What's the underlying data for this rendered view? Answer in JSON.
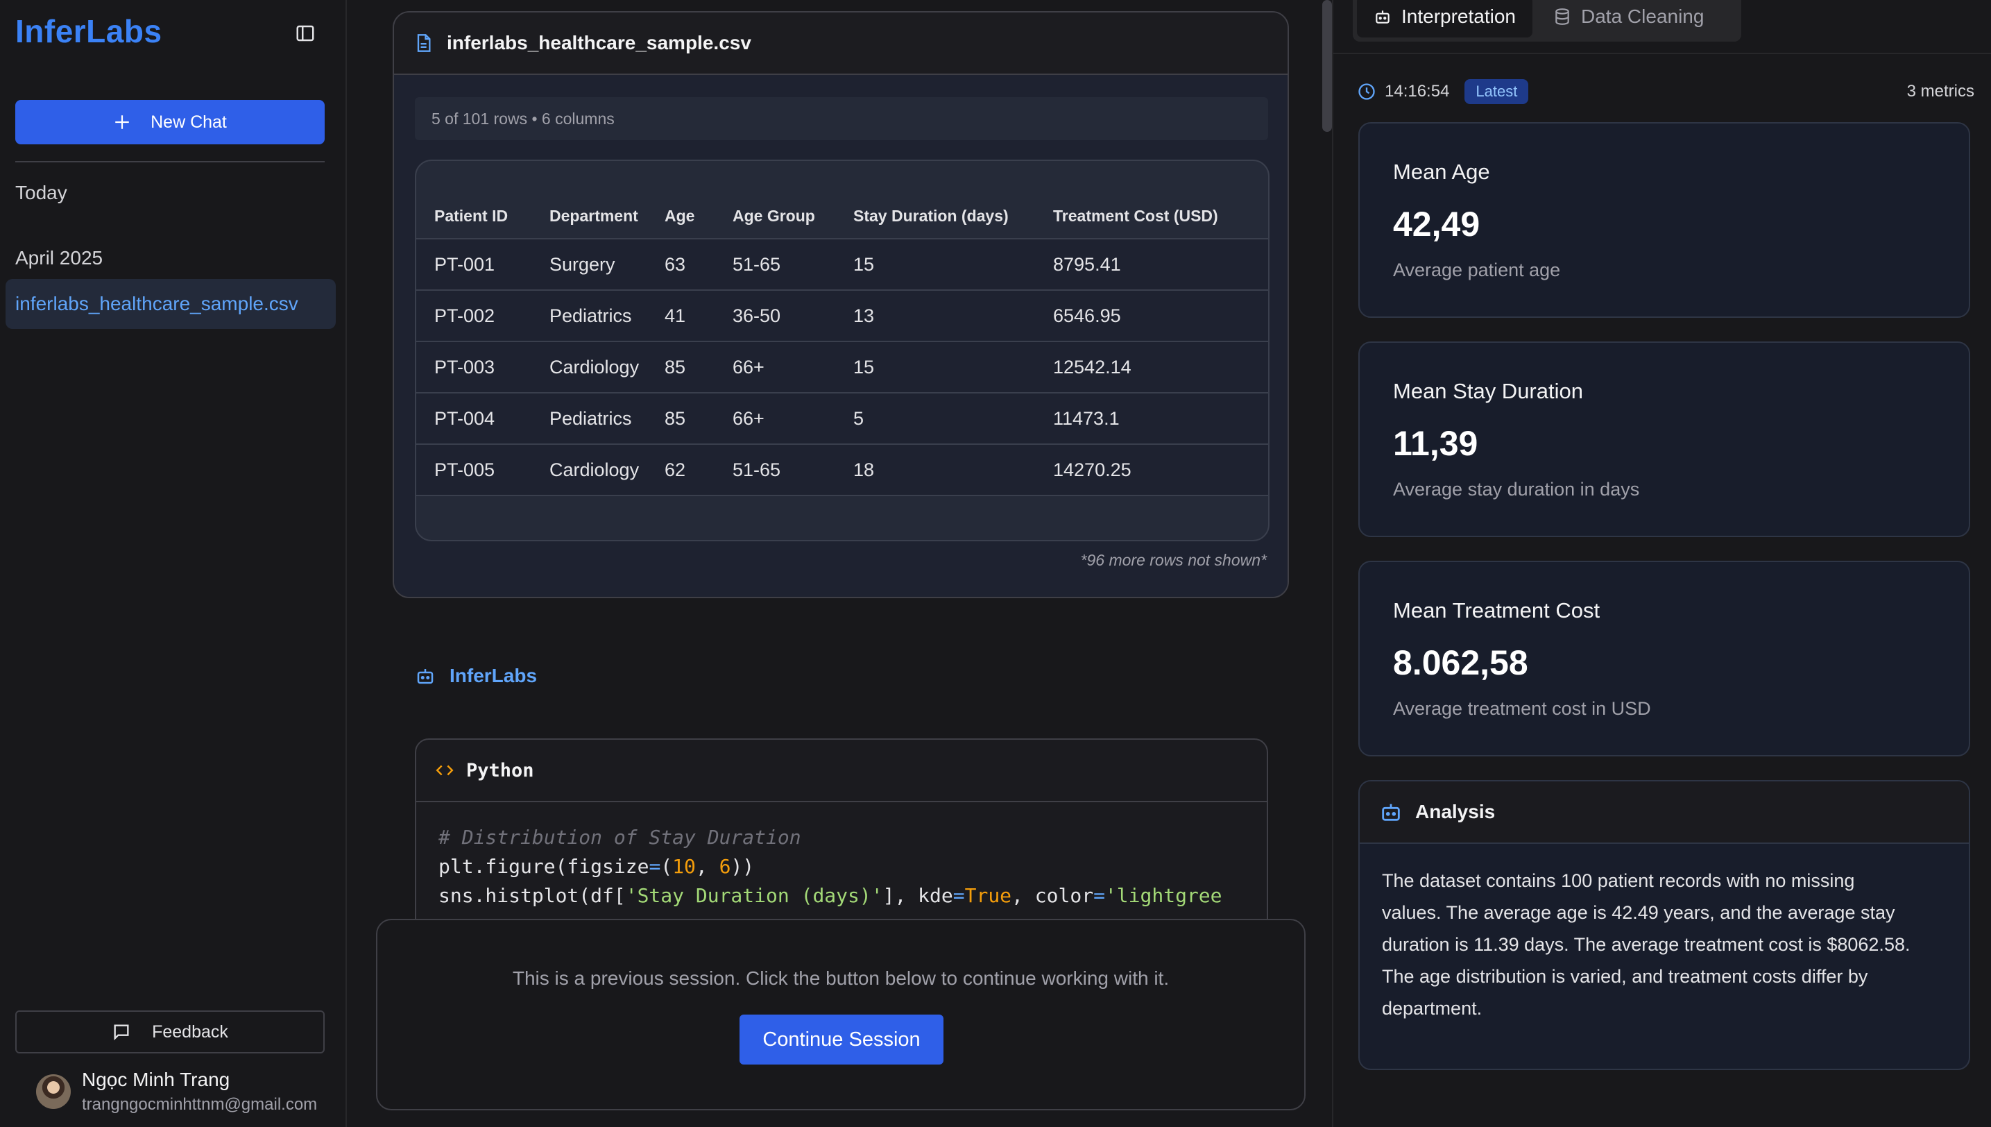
{
  "sidebar": {
    "brand": "InferLabs",
    "new_chat_label": "New Chat",
    "groups": [
      {
        "label": "Today"
      },
      {
        "label": "April 2025"
      }
    ],
    "history_items": [
      {
        "label": "inferlabs_healthcare_sample.csv"
      }
    ],
    "feedback_label": "Feedback",
    "user": {
      "name": "Ngọc Minh Trang",
      "email": "trangngocminhttnm@gmail.com"
    }
  },
  "file_preview": {
    "filename": "inferlabs_healthcare_sample.csv",
    "rows_info": "5 of 101 rows • 6 columns",
    "columns": [
      "Patient ID",
      "Department",
      "Age",
      "Age Group",
      "Stay Duration (days)",
      "Treatment Cost (USD)"
    ],
    "rows": [
      [
        "PT-001",
        "Surgery",
        "63",
        "51-65",
        "15",
        "8795.41"
      ],
      [
        "PT-002",
        "Pediatrics",
        "41",
        "36-50",
        "13",
        "6546.95"
      ],
      [
        "PT-003",
        "Cardiology",
        "85",
        "66+",
        "15",
        "12542.14"
      ],
      [
        "PT-004",
        "Pediatrics",
        "85",
        "66+",
        "5",
        "11473.1"
      ],
      [
        "PT-005",
        "Cardiology",
        "62",
        "51-65",
        "18",
        "14270.25"
      ]
    ],
    "more_rows": "*96 more rows not shown*"
  },
  "assistant": {
    "name": "InferLabs"
  },
  "code": {
    "language": "Python",
    "comment": "# Distribution of Stay Duration",
    "line2": {
      "a": "plt.figure(figsize",
      "op": "=",
      "b": "(",
      "n1": "10",
      "c": ", ",
      "n2": "6",
      "d": "))"
    },
    "line3": {
      "a": "sns.histplot(df[",
      "s1": "'Stay Duration (days)'",
      "b": "], kde",
      "op1": "=",
      "kw": "True",
      "c": ", color",
      "op2": "=",
      "s2": "'lightgree"
    }
  },
  "session": {
    "message": "This is a previous session. Click the button below to continue working with it.",
    "button_label": "Continue Session"
  },
  "right_panel": {
    "tabs": [
      {
        "label": "Interpretation",
        "active": true
      },
      {
        "label": "Data Cleaning",
        "active": false
      }
    ],
    "time": "14:16:54",
    "badge": "Latest",
    "metric_count": "3 metrics",
    "metrics": [
      {
        "title": "Mean Age",
        "value": "42,49",
        "description": "Average patient age"
      },
      {
        "title": "Mean Stay Duration",
        "value": "11,39",
        "description": "Average stay duration in days"
      },
      {
        "title": "Mean Treatment Cost",
        "value": "8.062,58",
        "description": "Average treatment cost in USD"
      }
    ],
    "analysis": {
      "title": "Analysis",
      "lines": [
        "The dataset contains 100 patient records with no missing",
        "values. The average age is 42.49 years, and the average stay",
        "duration is 11.39 days. The average treatment cost is $8062.58.",
        "The age distribution is varied, and treatment costs differ by",
        "department."
      ]
    }
  },
  "colors": {
    "accent": "#2f5fe8",
    "link": "#60a5fa",
    "background": "#18181b"
  }
}
